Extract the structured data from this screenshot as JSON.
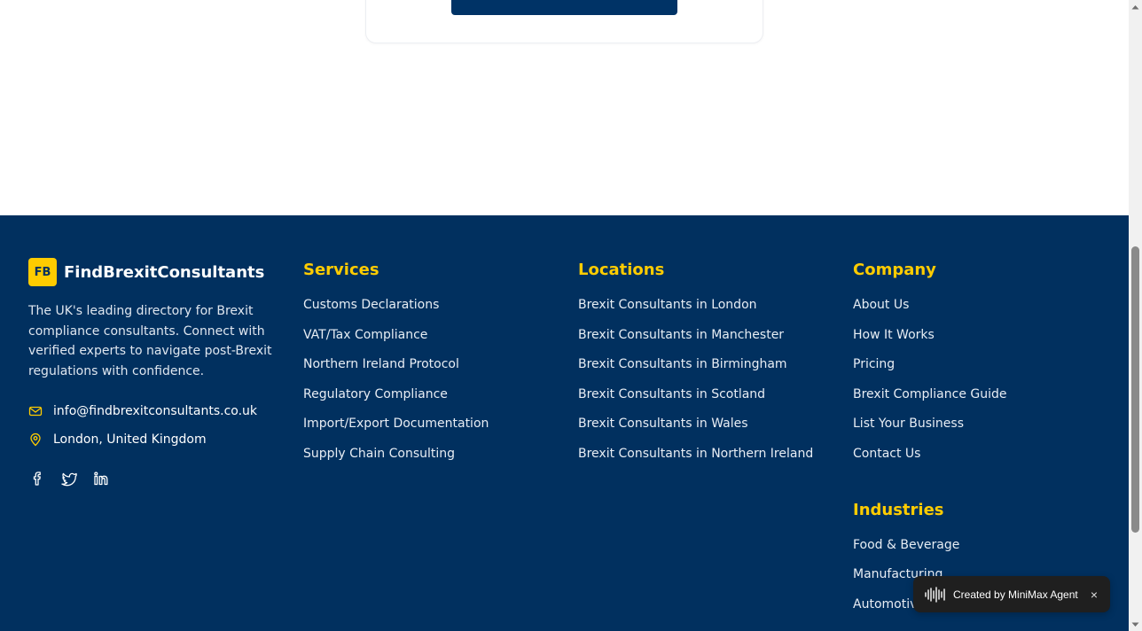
{
  "brand": {
    "logo_text": "FB",
    "name": "FindBrexitConsultants",
    "description": "The UK's leading directory for Brexit compliance consultants. Connect with verified experts to navigate post-Brexit regulations with confidence.",
    "email": "info@findbrexitconsultants.co.uk",
    "location": "London, United Kingdom",
    "socials": [
      "facebook-icon",
      "twitter-icon",
      "linkedin-icon"
    ]
  },
  "services": {
    "heading": "Services",
    "items": [
      "Customs Declarations",
      "VAT/Tax Compliance",
      "Northern Ireland Protocol",
      "Regulatory Compliance",
      "Import/Export Documentation",
      "Supply Chain Consulting"
    ]
  },
  "locations": {
    "heading": "Locations",
    "items": [
      "Brexit Consultants in London",
      "Brexit Consultants in Manchester",
      "Brexit Consultants in Birmingham",
      "Brexit Consultants in Scotland",
      "Brexit Consultants in Wales",
      "Brexit Consultants in Northern Ireland"
    ]
  },
  "company": {
    "heading": "Company",
    "items": [
      "About Us",
      "How It Works",
      "Pricing",
      "Brexit Compliance Guide",
      "List Your Business",
      "Contact Us"
    ]
  },
  "industries": {
    "heading": "Industries",
    "items": [
      "Food & Beverage",
      "Manufacturing",
      "Automotive"
    ]
  },
  "badge": {
    "text": "Created by MiniMax Agent",
    "close": "×"
  },
  "colors": {
    "footer_bg": "#01305f",
    "accent": "#ffcc00",
    "button": "#003366"
  }
}
